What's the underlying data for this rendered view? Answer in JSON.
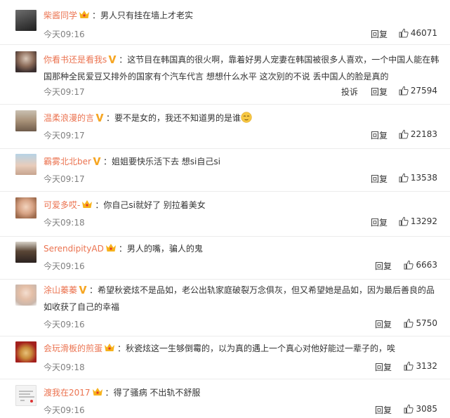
{
  "comments": [
    {
      "user": "柴酱同学",
      "badge": "crown",
      "text": "男人只有挂在墙上才老实",
      "time": "今天09:16",
      "reply": "回复",
      "likes": "46071",
      "report": ""
    },
    {
      "user": "你看书还是看我s",
      "badge": "v",
      "text": "这节目在韩国真的很火啊，靠着好男人宠妻在韩国被很多人喜欢，一个中国人能在韩国那种全民爱豆又排外的国家有个汽车代言 想想什么水平 这次别的不说 丢中国人的脸是真的",
      "time": "今天09:17",
      "reply": "回复",
      "likes": "27594",
      "report": "投诉"
    },
    {
      "user": "温柔浪漫的言",
      "badge": "v",
      "text": "要不是女的，我还不知道男的是谁",
      "time": "今天09:17",
      "reply": "回复",
      "likes": "22183",
      "report": ""
    },
    {
      "user": "霸雾北北ber",
      "badge": "v",
      "text": "姐姐要快乐活下去 想si自己si",
      "time": "今天09:17",
      "reply": "回复",
      "likes": "13538",
      "report": ""
    },
    {
      "user": "可爱多哎-",
      "badge": "crown",
      "text": "你自己si就好了 别拉着美女",
      "time": "今天09:18",
      "reply": "回复",
      "likes": "13292",
      "report": ""
    },
    {
      "user": "SerendipityAD",
      "badge": "crown",
      "text": "男人的嘴，骗人的鬼",
      "time": "今天09:16",
      "reply": "回复",
      "likes": "6663",
      "report": ""
    },
    {
      "user": "涂山蓁蓁",
      "badge": "v",
      "text": "希望秋瓷炫不是品如，老公出轨家庭破裂万念俱灰，但又希望她是品如，因为最后善良的品如收获了自己的幸福",
      "time": "今天09:16",
      "reply": "回复",
      "likes": "5750",
      "report": ""
    },
    {
      "user": "会玩滑板的煎蛋",
      "badge": "crown",
      "text": "秋瓷炫这一生够倒霉的，以为真的遇上一个真心对他好能过一辈子的，唉",
      "time": "今天09:18",
      "reply": "回复",
      "likes": "3132",
      "report": ""
    },
    {
      "user": "渡我在2017",
      "badge": "crown",
      "text": "得了骚病 不出轨不舒服",
      "time": "今天09:16",
      "reply": "回复",
      "likes": "3085",
      "report": ""
    }
  ],
  "colors": {
    "username": "#eb7350",
    "time": "#808080",
    "text": "#333333",
    "divider": "#ececec",
    "badge_v": "#f6a623",
    "badge_crown": "#f7b21c"
  },
  "icons": {
    "like": "thumbs-up-icon",
    "badge_v": "v-verified-icon",
    "badge_crown": "crown-member-icon",
    "emoji": "sleepy-face-emoji"
  }
}
